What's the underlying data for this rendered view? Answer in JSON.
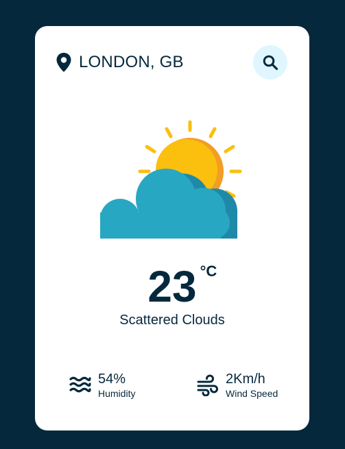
{
  "location": {
    "city": "LONDON, GB",
    "icon": "map-pin-icon"
  },
  "search": {
    "icon": "search-icon"
  },
  "weather": {
    "icon": "sun-behind-cloud-icon",
    "temperature": "23",
    "unit": "°C",
    "description": "Scattered Clouds"
  },
  "details": {
    "humidity": {
      "value": "54%",
      "label": "Humidity",
      "icon": "water-waves-icon"
    },
    "wind": {
      "value": "2Km/h",
      "label": "Wind Speed",
      "icon": "wind-icon"
    }
  },
  "colors": {
    "background": "#06283d",
    "card": "#ffffff",
    "primary_text": "#06283d",
    "search_button_bg": "#dff6ff",
    "sun": "#fbbf0e",
    "sun_shadow": "#f29d25",
    "cloud": "#28a7c3",
    "cloud_shadow": "#1e8aa8"
  }
}
